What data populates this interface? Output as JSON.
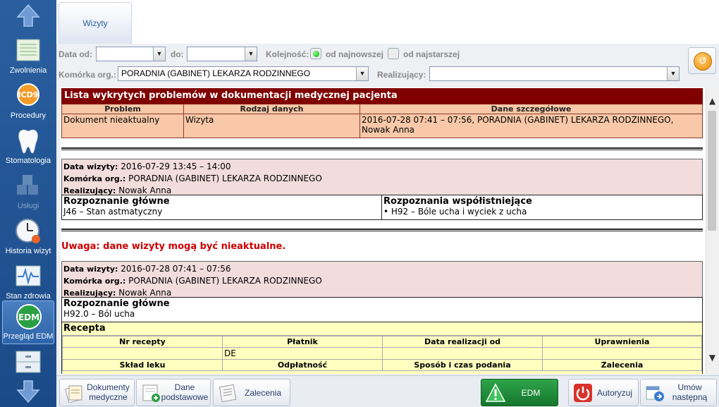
{
  "sidebar": {
    "items": [
      {
        "label": "Zwolnienia",
        "icon": "document-icon"
      },
      {
        "label": "Procedury",
        "icon": "icd9-icon"
      },
      {
        "label": "Stomatologia",
        "icon": "tooth-icon"
      },
      {
        "label": "Usługi",
        "icon": "cubes-icon"
      },
      {
        "label": "Historia wizyt",
        "icon": "clock-icon"
      },
      {
        "label": "Stan zdrowia",
        "icon": "heartbeat-icon"
      },
      {
        "label": "Przegląd EDM",
        "icon": "edm-icon"
      }
    ]
  },
  "tab": {
    "label": "Wizyty"
  },
  "filters": {
    "date_from_label": "Data od:",
    "date_from_value": "",
    "date_to_label": "do:",
    "date_to_value": "",
    "order_label": "Kolejność:",
    "order_newest": "od najnowszej",
    "order_oldest": "od najstarszej",
    "unit_label": "Komórka org.:",
    "unit_value": "PORADNIA (GABINET) LEKARZA RODZINNEGO",
    "performer_label": "Realizujący:",
    "performer_value": ""
  },
  "problems": {
    "title": "Lista wykrytych problemów w dokumentacji medycznej pacjenta",
    "columns": [
      "Problem",
      "Rodzaj danych",
      "Dane szczegółowe"
    ],
    "rows": [
      [
        "Dokument nieaktualny",
        "Wizyta",
        "2016-07-28 07:41 – 07:56, PORADNIA (GABINET) LEKARZA RODZINNEGO, Nowak Anna"
      ]
    ]
  },
  "visit1": {
    "date_label": "Data wizyty:",
    "date_value": " 2016-07-29 13:45 – 14:00",
    "unit_label": "Komórka org.:",
    "unit_value": " PORADNIA (GABINET) LEKARZA RODZINNEGO",
    "performer_label": "Realizujący:",
    "performer_value": " Nowak Anna",
    "main_dx_title": "Rozpoznanie główne",
    "main_dx_value": "J46 – Stan astmatyczny",
    "co_dx_title": "Rozpoznania współistniejące",
    "co_dx_value": "• H92 – Bóle ucha i wyciek z ucha"
  },
  "warning": "Uwaga: dane wizyty mogą być nieaktualne.",
  "visit2": {
    "date_label": "Data wizyty:",
    "date_value": " 2016-07-28 07:41 – 07:56",
    "unit_label": "Komórka org.:",
    "unit_value": " PORADNIA (GABINET) LEKARZA RODZINNEGO",
    "performer_label": "Realizujący:",
    "performer_value": " Nowak Anna",
    "main_dx_title": "Rozpoznanie główne",
    "main_dx_value": "H92.0 – Ból ucha",
    "recipe_title": "Recepta",
    "recipe_cols1": [
      "Nr recepty",
      "Płatnik",
      "Data realizacji od",
      "Uprawnienia"
    ],
    "recipe_row1": [
      "",
      "DE",
      "",
      ""
    ],
    "recipe_cols2": [
      "Skład leku",
      "Odpłatność",
      "Sposób i czas podania",
      "Zalecenia"
    ]
  },
  "bottom": {
    "docs_label": "Dokumenty medyczne",
    "basic_label": "Dane podstawowe",
    "recs_label": "Zalecenia",
    "edm_label": "EDM",
    "auth_label": "Autoryzuj",
    "next_label": "Umów następną"
  },
  "colors": {
    "accent": "#800000",
    "problem_bg": "#f8c8a8",
    "visit_bg": "#f2dcdc",
    "recipe_bg": "#ffffc0",
    "edm_green": "#1f8f3c"
  }
}
